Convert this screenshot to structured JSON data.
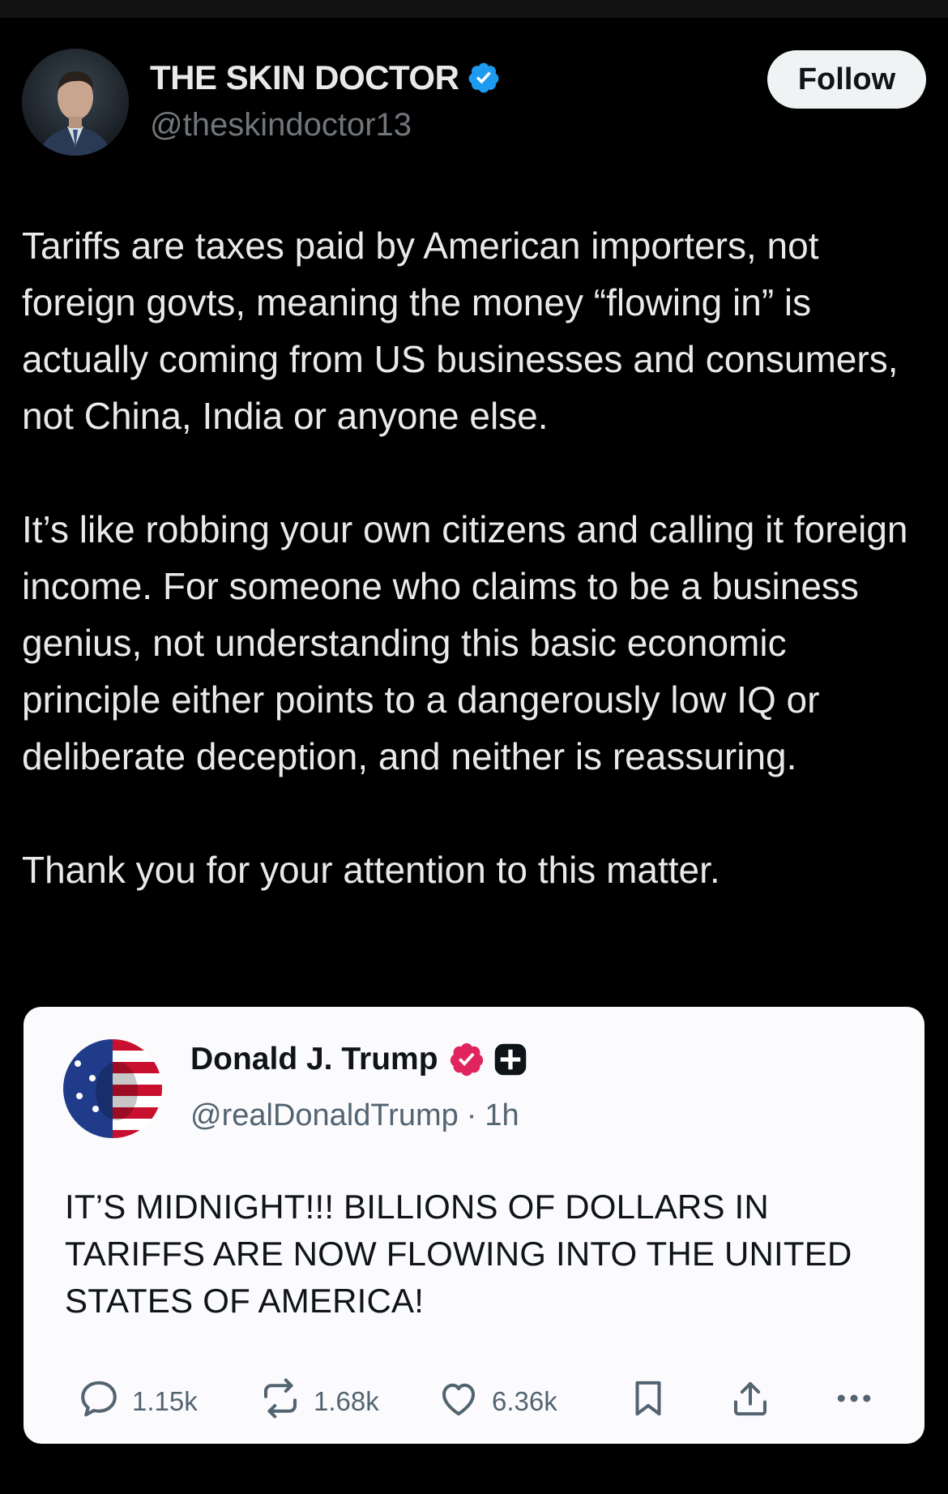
{
  "post": {
    "author": {
      "display_name": "THE SKIN DOCTOR",
      "handle": "@theskindoctor13",
      "verified_color": "#1d9bf0"
    },
    "follow_label": "Follow",
    "paragraphs": [
      "Tariffs are taxes paid by American importers, not foreign govts, meaning the money “flowing in” is actually coming from US businesses and consumers, not China, India or anyone else.",
      "It’s like robbing your own citizens and calling it foreign income. For someone who claims to be a business genius, not understanding this basic economic principle either points to a dangerously low IQ or deliberate deception, and neither is reassuring.",
      "Thank you for your attention to this matter."
    ]
  },
  "quoted": {
    "author": {
      "display_name": "Donald J. Trump",
      "handle": "@realDonaldTrump",
      "separator": "·",
      "time": "1h",
      "badge_color": "#e0245e"
    },
    "text": "IT’S MIDNIGHT!!! BILLIONS OF DOLLARS IN TARIFFS ARE NOW FLOWING INTO THE UNITED STATES OF AMERICA!",
    "actions": {
      "replies": "1.15k",
      "reposts": "1.68k",
      "likes": "6.36k"
    },
    "icons": [
      "reply-icon",
      "repost-icon",
      "like-icon",
      "bookmark-icon",
      "share-icon",
      "more-icon"
    ]
  }
}
